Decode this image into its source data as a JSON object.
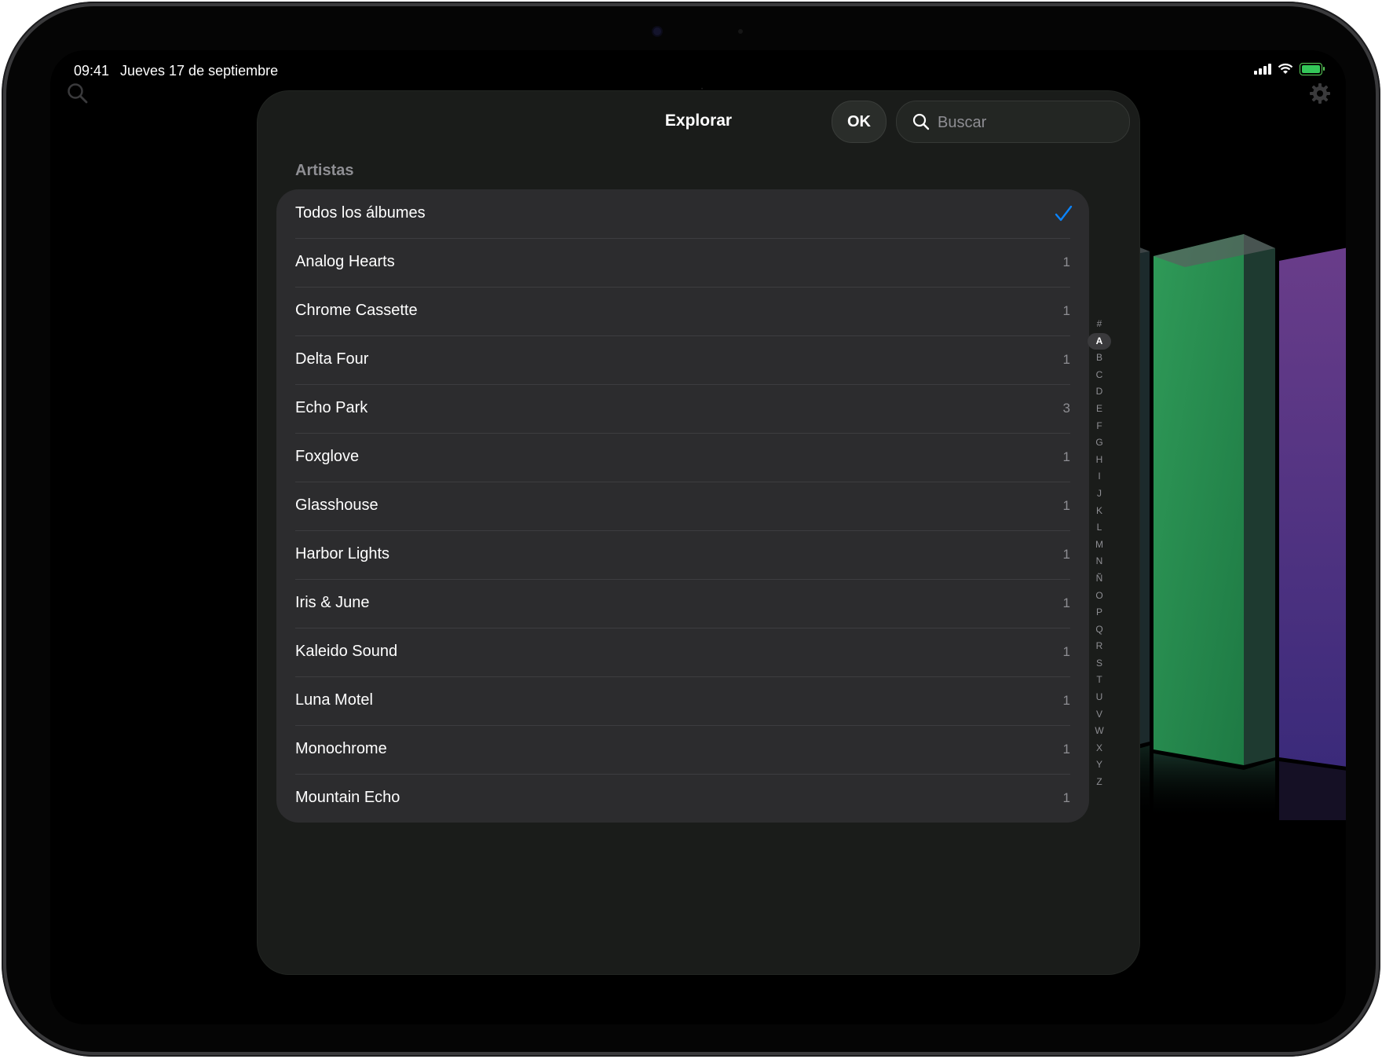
{
  "status_bar": {
    "time": "09:41",
    "date": "Jueves 17 de septiembre"
  },
  "sheet": {
    "title": "Explorar",
    "ok_label": "OK",
    "search_placeholder": "Buscar",
    "section_header": "Artistas",
    "selected_row": {
      "label": "Todos los álbumes",
      "icon": "checkmark-icon"
    },
    "rows": [
      {
        "label": "Analog Hearts",
        "count": "1"
      },
      {
        "label": "Chrome Cassette",
        "count": "1"
      },
      {
        "label": "Delta Four",
        "count": "1"
      },
      {
        "label": "Echo Park",
        "count": "3"
      },
      {
        "label": "Foxglove",
        "count": "1"
      },
      {
        "label": "Glasshouse",
        "count": "1"
      },
      {
        "label": "Harbor Lights",
        "count": "1"
      },
      {
        "label": "Iris & June",
        "count": "1"
      },
      {
        "label": "Kaleido Sound",
        "count": "1"
      },
      {
        "label": "Luna Motel",
        "count": "1"
      },
      {
        "label": "Monochrome",
        "count": "1"
      },
      {
        "label": "Mountain Echo",
        "count": "1"
      }
    ],
    "index_letters": [
      "#",
      "A",
      "B",
      "C",
      "D",
      "E",
      "F",
      "G",
      "H",
      "I",
      "J",
      "K",
      "L",
      "M",
      "N",
      "Ñ",
      "O",
      "P",
      "Q",
      "R",
      "S",
      "T",
      "U",
      "V",
      "W",
      "X",
      "Y",
      "Z"
    ],
    "active_index": "A"
  },
  "colors": {
    "accent": "#0a84ff",
    "battery": "#34c759",
    "sheet_bg": "#1a1c1a",
    "row_bg": "#2c2c2e"
  },
  "icons": [
    "search-icon",
    "gear-icon",
    "checkmark-icon",
    "cellular-icon",
    "wifi-icon",
    "battery-icon"
  ]
}
